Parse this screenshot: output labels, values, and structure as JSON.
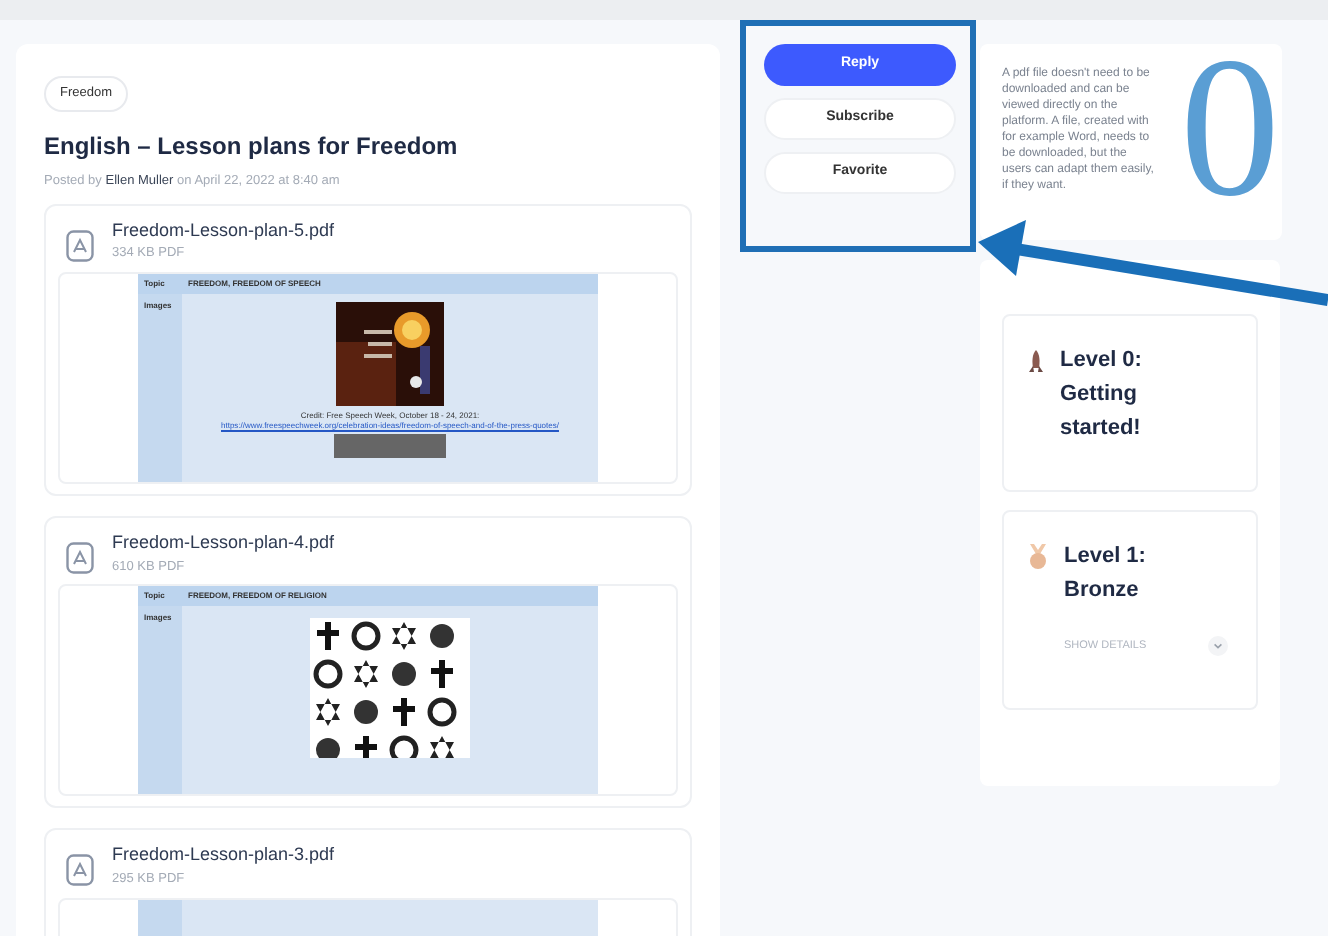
{
  "tag": "Freedom",
  "title": "English – Lesson plans for Freedom",
  "byline": {
    "prefix": "Posted by",
    "author": "Ellen Muller",
    "suffix": "on April 22, 2022 at 8:40 am"
  },
  "attachments": [
    {
      "name": "Freedom-Lesson-plan-5.pdf",
      "size": "334 KB",
      "type": "PDF",
      "preview": {
        "topic_label": "Topic",
        "topic": "FREEDOM, FREEDOM OF SPEECH",
        "images_label": "Images",
        "credit": "Credit: Free Speech Week, October 18 - 24, 2021:",
        "link": "https://www.freespeechweek.org/celebration-ideas/freedom-of-speech-and-of-the-press-quotes/"
      }
    },
    {
      "name": "Freedom-Lesson-plan-4.pdf",
      "size": "610 KB",
      "type": "PDF",
      "preview": {
        "kind": "symbols",
        "topic_label": "Topic",
        "topic": "FREEDOM, FREEDOM OF RELIGION",
        "images_label": "Images"
      }
    },
    {
      "name": "Freedom-Lesson-plan-3.pdf",
      "size": "295 KB",
      "type": "PDF",
      "preview": {
        "kind": "blank"
      }
    }
  ],
  "actions": [
    {
      "label": "Reply",
      "primary": true
    },
    {
      "label": "Subscribe",
      "primary": false
    },
    {
      "label": "Favorite",
      "primary": false
    }
  ],
  "info": "A pdf file doesn't need to be downloaded and can be viewed directly on the platform. A file, created with for example Word, needs to be downloaded, but the users can adapt them easily, if they want.",
  "levels": [
    {
      "kind": "rocket",
      "title": "Level 0: Getting started!"
    },
    {
      "kind": "medal",
      "title": "Level 1: Bronze",
      "details": "SHOW DETAILS"
    }
  ],
  "annotation": {
    "label": "0"
  }
}
